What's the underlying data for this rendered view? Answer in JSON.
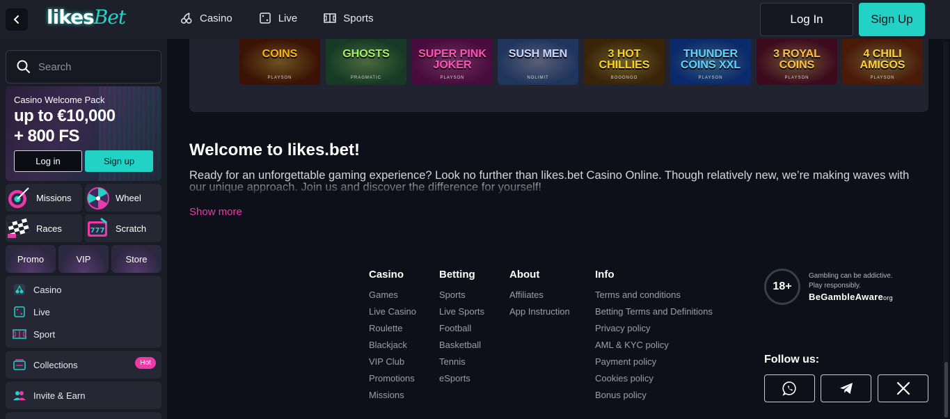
{
  "header": {
    "logo_a": "likes",
    "logo_b": "Bet",
    "nav": [
      {
        "label": "Casino",
        "icon": "cherries-icon"
      },
      {
        "label": "Live",
        "icon": "dice-icon"
      },
      {
        "label": "Sports",
        "icon": "football-pitch-icon"
      }
    ],
    "login_label": "Log In",
    "signup_label": "Sign Up"
  },
  "sidebar": {
    "search_placeholder": "Search",
    "promo": {
      "subtitle": "Casino Welcome Pack",
      "headline_1": "up to €10,000",
      "headline_2": "+ 800 FS",
      "login_label": "Log in",
      "signup_label": "Sign up"
    },
    "tiles": [
      {
        "label": "Missions",
        "icon": "target-icon"
      },
      {
        "label": "Wheel",
        "icon": "wheel-icon"
      },
      {
        "label": "Races",
        "icon": "race-flag-icon"
      },
      {
        "label": "Scratch",
        "icon": "scratch-card-icon"
      }
    ],
    "small_tiles": [
      "Promo",
      "VIP",
      "Store"
    ],
    "menu": [
      {
        "label": "Casino",
        "icon": "cherries-icon"
      },
      {
        "label": "Live",
        "icon": "dice-icon"
      },
      {
        "label": "Sport",
        "icon": "football-pitch-icon"
      }
    ],
    "collections": {
      "label": "Collections",
      "badge": "Hot"
    },
    "invite": {
      "label": "Invite & Earn"
    }
  },
  "games": [
    {
      "title": "COINS",
      "provider": "PLAYSON",
      "bg": "#3b1205",
      "accent": "#ffb300"
    },
    {
      "title": "GHOSTS",
      "provider": "PRAGMATIC",
      "bg": "#163a25",
      "accent": "#9ef45a"
    },
    {
      "title": "SUPER PINK JOKER",
      "provider": "PLAYSON",
      "bg": "#4a0b3d",
      "accent": "#ff4fb8"
    },
    {
      "title": "SUSH MEN",
      "provider": "NOLIMIT",
      "bg": "#20355e",
      "accent": "#c7d6ff"
    },
    {
      "title": "3 HOT CHILLIES",
      "provider": "BOOONGO",
      "bg": "#3a2408",
      "accent": "#ffd21a"
    },
    {
      "title": "THUNDER COINS XXL",
      "provider": "PLAYSON",
      "bg": "#0b2a6b",
      "accent": "#5fd1ff"
    },
    {
      "title": "3 ROYAL COINS",
      "provider": "PLAYSON",
      "bg": "#3e0b1e",
      "accent": "#ffbf3c"
    },
    {
      "title": "4 CHILI AMIGOS",
      "provider": "PLAYSON",
      "bg": "#4a1a08",
      "accent": "#ffcf3c"
    }
  ],
  "welcome": {
    "title": "Welcome to likes.bet!",
    "text": "Ready for an unforgettable gaming experience? Look no further than likes.bet Casino Online. Though relatively new, we’re making waves with our unique approach. Join us and discover the difference for yourself!",
    "show_more": "Show more"
  },
  "footer": {
    "columns": [
      {
        "title": "Casino",
        "links": [
          "Games",
          "Live Casino",
          "Roulette",
          "Blackjack",
          "VIP Club",
          "Promotions",
          "Missions"
        ]
      },
      {
        "title": "Betting",
        "links": [
          "Sports",
          "Live Sports",
          "Football",
          "Basketball",
          "Tennis",
          "eSports"
        ]
      },
      {
        "title": "About",
        "links": [
          "Affiliates",
          "App Instruction"
        ]
      },
      {
        "title": "Info",
        "links": [
          "Terms and conditions",
          "Betting Terms and Definitions",
          "Privacy policy",
          "AML & KYC policy",
          "Payment policy",
          "Cookies policy",
          "Bonus policy"
        ]
      }
    ],
    "age": "18+",
    "gamble_note_1": "Gambling can be addictive.",
    "gamble_note_2": "Play responsibly.",
    "gamble_brand": "BeGambleAware",
    "gamble_brand_suffix": "org",
    "follow_label": "Follow us:",
    "socials": [
      "whatsapp-icon",
      "telegram-icon",
      "x-icon"
    ]
  },
  "colors": {
    "accent": "#22d3c5",
    "pink": "#e93aa8",
    "bg": "#0e1019",
    "panel": "#1d1f2a"
  }
}
